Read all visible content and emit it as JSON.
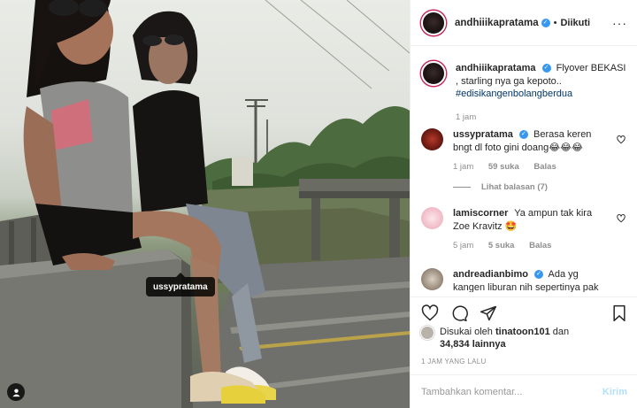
{
  "post": {
    "author": "andhiiikapratama",
    "follow_dot": "•",
    "follow_status": "Diikuti",
    "more": "···",
    "photo_tag": "ussypratama"
  },
  "caption": {
    "username": "andhiiikapratama",
    "text": "Flyover BEKASI , starling nya ga kepoto..",
    "hashtag": "#edisikangenbolangberdua",
    "time": "1 jam"
  },
  "comments": [
    {
      "username": "ussypratama",
      "text": "Berasa keren bngt dl foto gini doang😂😂😂",
      "likes": "59 suka",
      "reply": "Balas",
      "view_replies": "Lihat balasan (7)"
    },
    {
      "username": "lamiscorner",
      "text": "Ya ampun tak kira Zoe Kravitz 🤩",
      "time": "5 jam",
      "likes": "5 suka",
      "reply": "Balas"
    },
    {
      "username": "andreadianbimo",
      "text": "Ada yg kangen liburan nih sepertinya pak"
    }
  ],
  "likes": {
    "prefix": "Disukai oleh",
    "user": "tinatoon101",
    "and": "dan",
    "count": "34,834 lainnya"
  },
  "timestamp": "1 JAM YANG LALU",
  "compose": {
    "placeholder": "Tambahkan komentar...",
    "send": "Kirim"
  },
  "icons": {
    "verified": "verified-badge",
    "heart": "heart-icon",
    "comment": "comment-icon",
    "share": "share-icon",
    "save": "bookmark-icon",
    "tag": "person-tag-icon"
  },
  "colors": {
    "accent": "#3897f0",
    "text": "#262626",
    "muted": "#8e8e8e",
    "send_disabled": "#b2dffc",
    "hashtag": "#003569"
  }
}
